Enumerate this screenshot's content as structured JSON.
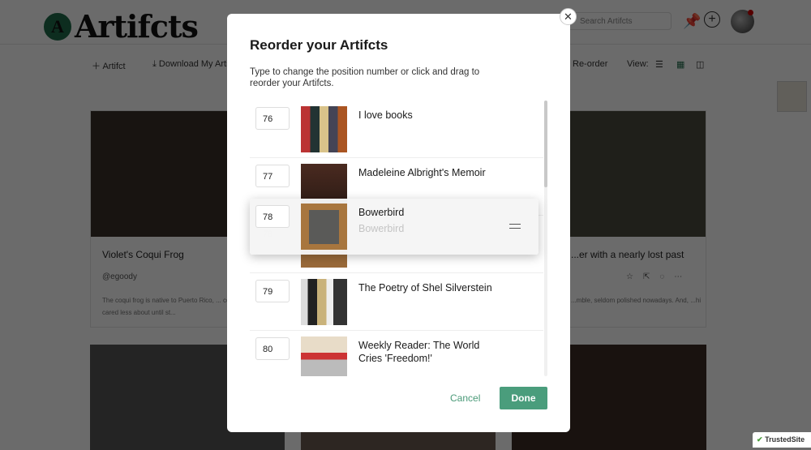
{
  "header": {
    "logo_text": "Artifcts",
    "logo_mark": "A",
    "search_placeholder": "Search Artifcts",
    "pin_icon": "pin-icon",
    "add_icon": "plus-circle-icon"
  },
  "toolbar": {
    "add_label": "Artifct",
    "download_label": "Download My Artifcts",
    "reorder_label": "Re-order",
    "view_label": "View:"
  },
  "cards": [
    {
      "title": "Violet's Coqui Frog",
      "author": "@egoody",
      "description": "The coqui frog is native to Puerto Rico, ... could not have cared less about until st..."
    },
    {
      "title": "...er with a nearly lost past",
      "author": "",
      "description": "...mble, seldom polished nowadays. And, ...hink of all the family members whos..."
    }
  ],
  "modal": {
    "title": "Reorder your Artifcts",
    "description": "Type to change the position number or click and drag to reorder your Artifcts.",
    "items": [
      {
        "position": "76",
        "title": "I love books"
      },
      {
        "position": "77",
        "title": "Madeleine Albright's Memoir"
      },
      {
        "position": "78",
        "title": "Bowerbird"
      },
      {
        "position": "79",
        "title": "The Poetry of Shel Silverstein"
      },
      {
        "position": "80",
        "title": "Weekly Reader: The World Cries 'Freedom!'"
      }
    ],
    "dragging": {
      "position": "78",
      "title": "Bowerbird"
    },
    "cancel_label": "Cancel",
    "done_label": "Done",
    "close_icon": "close-icon"
  },
  "trusted_label": "TrustedSite",
  "colors": {
    "accent": "#4a9d7c",
    "logo": "#1f6b4a"
  }
}
